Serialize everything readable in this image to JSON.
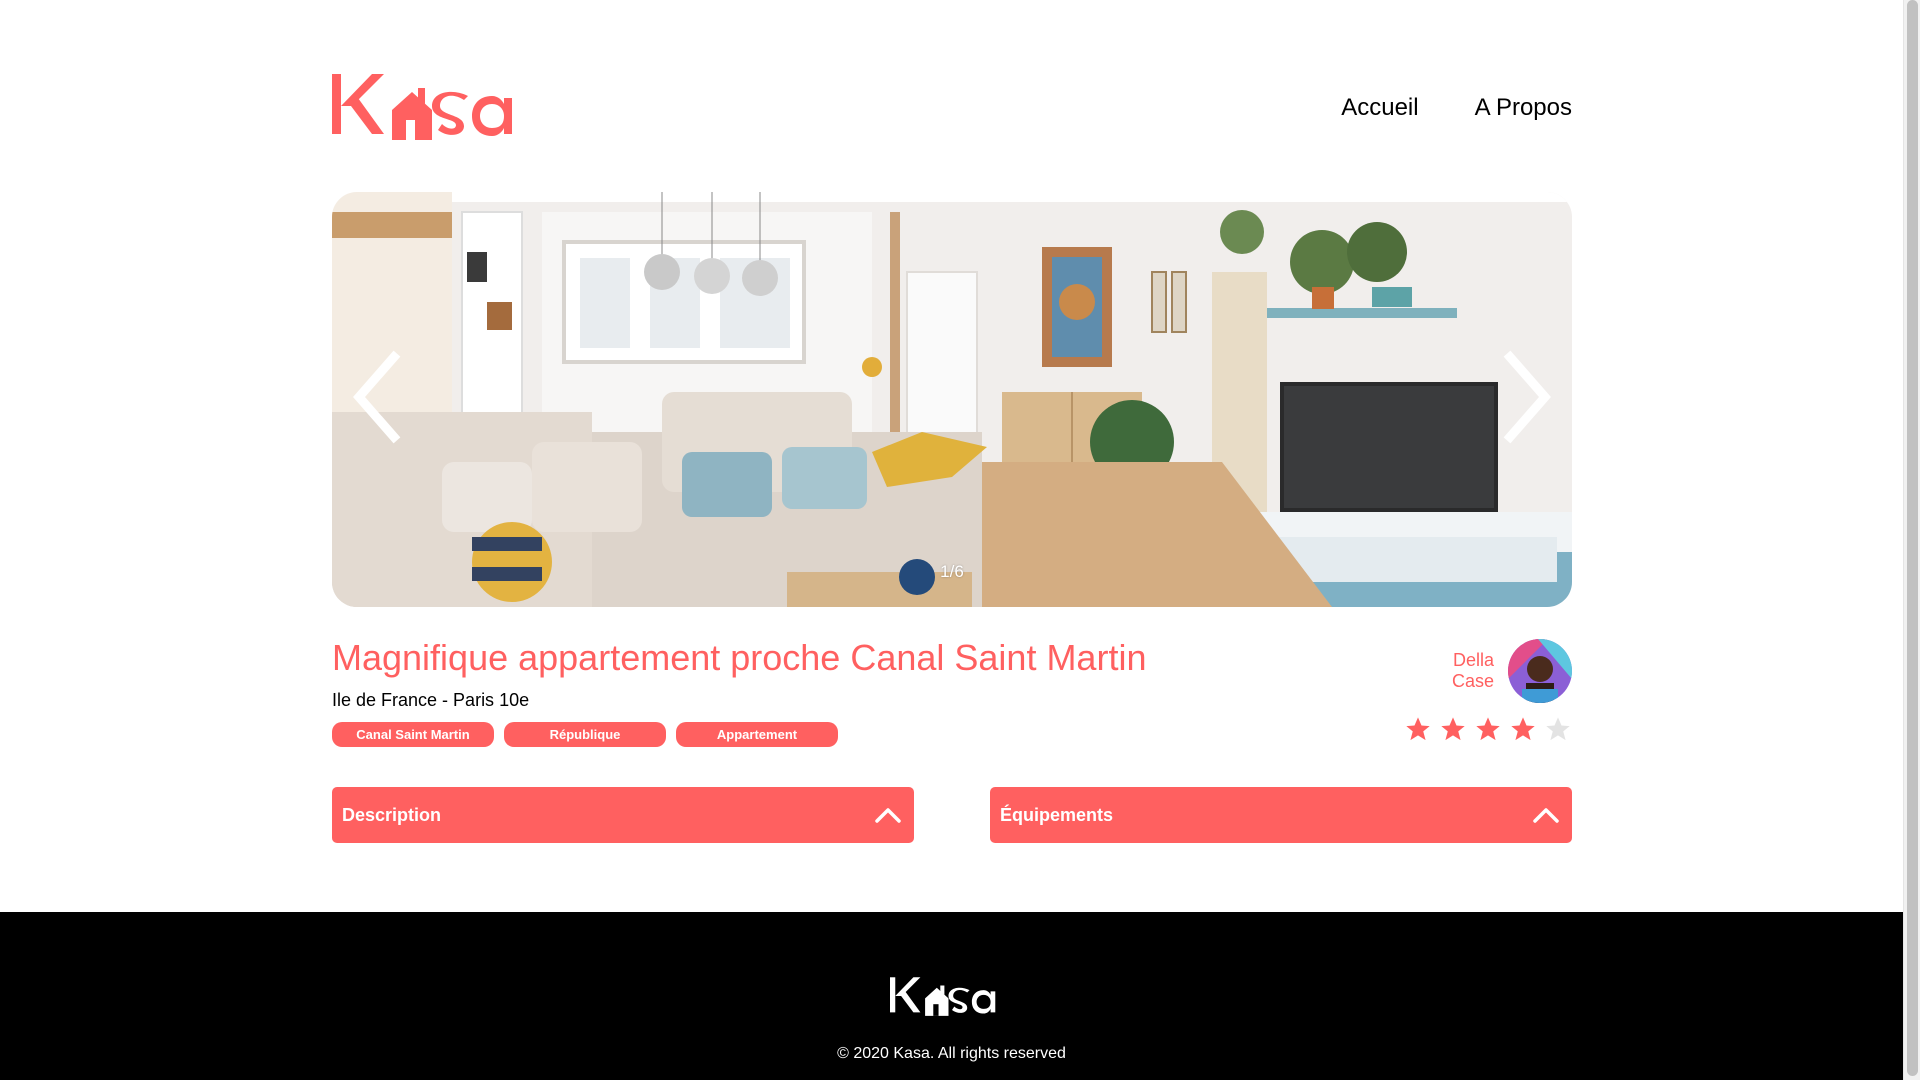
{
  "header": {
    "logo_alt": "Kasa",
    "nav": [
      {
        "label": "Accueil"
      },
      {
        "label": "A Propos"
      }
    ]
  },
  "carousel": {
    "counter": "1/6",
    "current": 1,
    "total": 6
  },
  "listing": {
    "title": "Magnifique appartement proche Canal Saint Martin",
    "location": "Ile de France - Paris 10e",
    "tags": [
      "Canal Saint Martin",
      "République",
      "Appartement"
    ],
    "host": {
      "first_name": "Della",
      "last_name": "Case"
    },
    "rating": 4,
    "rating_max": 5
  },
  "collapses": [
    {
      "title": "Description"
    },
    {
      "title": "Équipements"
    }
  ],
  "footer": {
    "logo_alt": "Kasa",
    "copyright": "© 2020 Kasa. All rights reserved"
  },
  "colors": {
    "accent": "#FF6060",
    "footer_bg": "#000000",
    "star_empty": "#E3E3E3"
  },
  "icons": {
    "prev": "chevron-left-icon",
    "next": "chevron-right-icon",
    "collapse": "chevron-up-icon",
    "star": "star-icon"
  }
}
